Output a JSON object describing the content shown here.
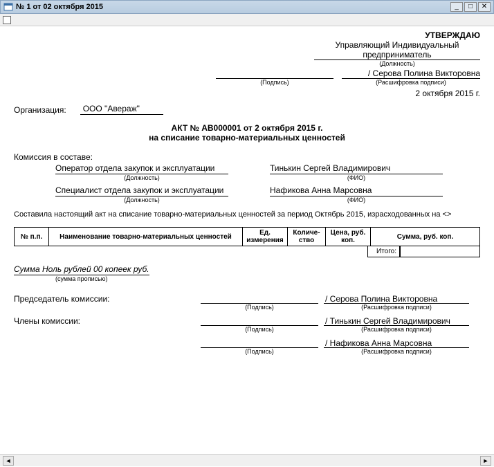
{
  "window": {
    "title": "№ 1 от 02 октября 2015"
  },
  "approve": {
    "title": "УТВЕРЖДАЮ",
    "position": "Управляющий Индивидуальный предприниматель",
    "position_caption": "(Должность)",
    "name": "/ Серова Полина Викторовна",
    "sign_caption": "(Подпись)",
    "name_caption": "(Расшифровка подписи)",
    "date": "2 октября 2015 г."
  },
  "org": {
    "label": "Организация:",
    "value": "ООО \"Авераж\""
  },
  "act": {
    "title": "АКТ № АВ000001 от 2 октября 2015 г.",
    "subtitle": "на списание товарно-материальных ценностей"
  },
  "commission": {
    "label": "Комиссия в составе:",
    "role_caption": "(Должность)",
    "name_caption": "(ФИО)",
    "members": [
      {
        "role": "Оператор отдела закупок и эксплуатации",
        "name": "Тинькин Сергей Владимирович"
      },
      {
        "role": "Специалист отдела закупок и эксплуатации",
        "name": "Нафикова Анна Марсовна"
      }
    ],
    "period_text": "Составила настоящий акт на списание товарно-материальных ценностей за период Октябрь 2015, израсходованных на <>"
  },
  "table": {
    "headers": {
      "num": "№ п.п.",
      "name": "Наименование товарно-материальных ценностей",
      "unit": "Ед. измерения",
      "qty": "Количе-ство",
      "price": "Цена, руб. коп.",
      "sum": "Сумма, руб. коп."
    },
    "total_label": "Итого:"
  },
  "amount": {
    "text": "Сумма Ноль рублей 00 копеек руб.",
    "caption": "(сумма прописью)"
  },
  "signatures": {
    "chairman_label": "Председатель комиссии:",
    "members_label": "Члены комиссии:",
    "sign_caption": "(Подпись)",
    "name_caption": "(Расшифровка подписи)",
    "lines": [
      {
        "name": "/ Серова Полина Викторовна"
      },
      {
        "name": "/ Тинькин Сергей Владимирович"
      },
      {
        "name": "/ Нафикова Анна Марсовна"
      }
    ]
  }
}
